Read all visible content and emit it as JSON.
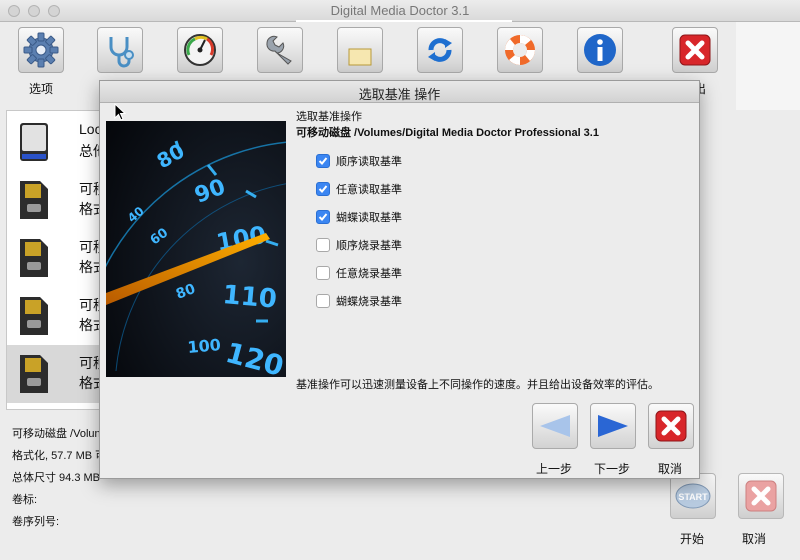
{
  "window": {
    "title": "Digital Media Doctor 3.1"
  },
  "toolbar": {
    "items": [
      {
        "label": "选项",
        "icon": "gear-icon"
      },
      {
        "label": "",
        "icon": "stethoscope-icon"
      },
      {
        "label": "",
        "icon": "gauge-icon"
      },
      {
        "label": "",
        "icon": "wrench-icon"
      },
      {
        "label": "",
        "icon": "document-icon"
      },
      {
        "label": "",
        "icon": "refresh-icon"
      },
      {
        "label": "",
        "icon": "lifebuoy-icon"
      },
      {
        "label": "",
        "icon": "info-icon"
      },
      {
        "label": "出",
        "icon": "close-icon"
      }
    ]
  },
  "drives": [
    {
      "line1": "Loc",
      "line2": "总他"
    },
    {
      "line1": "可移",
      "line2": "格式"
    },
    {
      "line1": "可移",
      "line2": "格式"
    },
    {
      "line1": "可移",
      "line2": "格式"
    },
    {
      "line1": "可移",
      "line2": "格式"
    }
  ],
  "info": {
    "disk": "可移动磁盘 /Volun",
    "format": "格式化, 57.7 MB 可",
    "total": "总体尺寸 94.3 MB",
    "volume_label": "卷标:",
    "serial_label": "卷序列号:"
  },
  "bottom": {
    "start_icon_text": "START",
    "start_label": "开始",
    "cancel_label": "取消"
  },
  "dialog": {
    "title": "选取基准 操作",
    "heading": "选取基准操作",
    "device": "可移动磁盘 /Volumes/Digital Media Doctor Professional 3.1",
    "options": [
      {
        "label": "顺序读取基準",
        "checked": true
      },
      {
        "label": "任意读取基準",
        "checked": true
      },
      {
        "label": "蝴蝶读取基準",
        "checked": true
      },
      {
        "label": "顺序烧录基準",
        "checked": false
      },
      {
        "label": "任意烧录基準",
        "checked": false
      },
      {
        "label": "蝴蝶烧录基準",
        "checked": false
      }
    ],
    "speedometer_numbers": [
      "80",
      "90",
      "100",
      "110",
      "120",
      "40",
      "60",
      "80",
      "100"
    ],
    "description": "基准操作可以迅速测量设备上不同操作的速度。并且给出设备效率的评估。",
    "buttons": {
      "prev": "上一步",
      "next": "下一步",
      "cancel": "取消"
    }
  }
}
